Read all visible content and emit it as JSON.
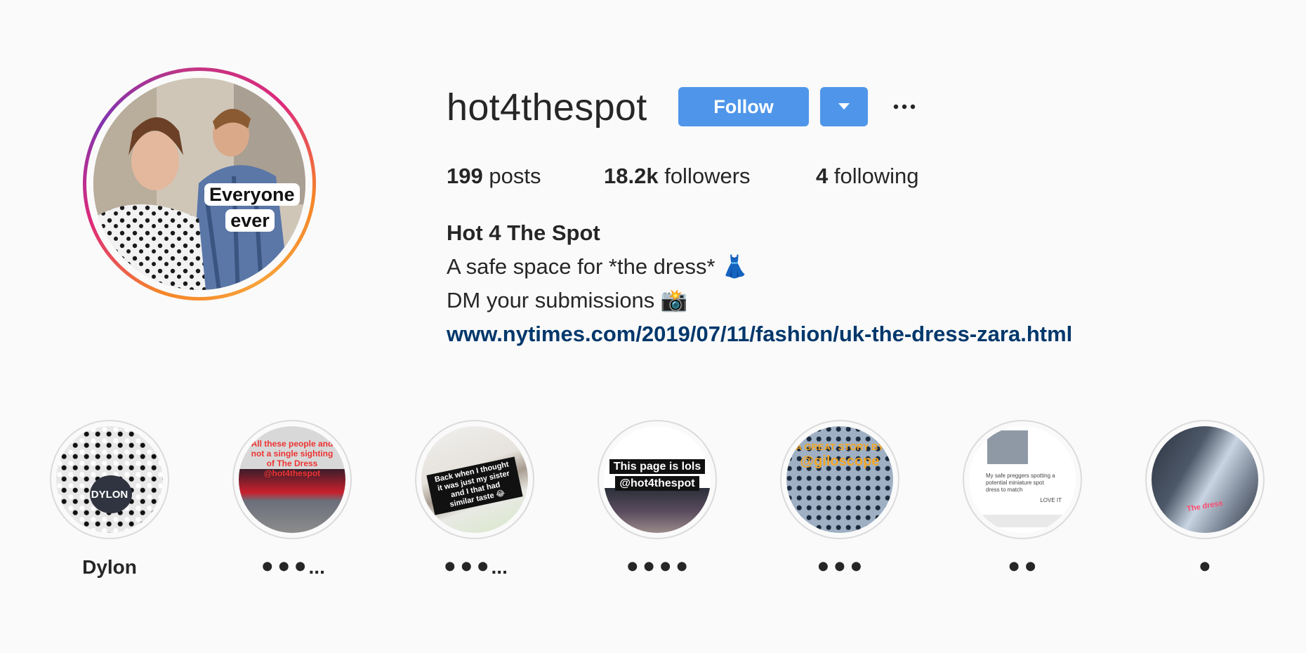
{
  "profile": {
    "username": "hot4thespot",
    "follow_label": "Follow",
    "avatar_caption": "Everyone ever",
    "stats": {
      "posts_count": "199",
      "posts_label": "posts",
      "followers_count": "18.2k",
      "followers_label": "followers",
      "following_count": "4",
      "following_label": "following"
    },
    "bio": {
      "full_name": "Hot 4 The Spot",
      "line1": "A safe space for *the dress* 👗",
      "line2": "DM your submissions 📸",
      "link": "www.nytimes.com/2019/07/11/fashion/uk-the-dress-zara.html"
    }
  },
  "highlights": [
    {
      "label": "Dylon",
      "cover_text": "DYLON"
    },
    {
      "label": "⚫⚫⚫...",
      "cover_text": "All these people and not a single sighting of The Dress @hot4thespot"
    },
    {
      "label": "⚫⚫⚫...",
      "cover_text": "Back when I thought it was just my sister and I that had similar taste 😂"
    },
    {
      "label": "⚫⚫⚫⚫",
      "cover_text": "This page is lols",
      "cover_text2": "@hot4thespot"
    },
    {
      "label": "⚫⚫⚫",
      "cover_text": "A GREAT STORY BY",
      "cover_text2": "@giloscope"
    },
    {
      "label": "⚫⚫",
      "cover_text": "My safe preggers spotting a potential miniature spot dress to match",
      "cover_text2": "LOVE IT"
    },
    {
      "label": "⚫",
      "cover_text": "The dress"
    }
  ],
  "colors": {
    "follow_button": "#4f96ea",
    "link": "#00376b",
    "background": "#fafafa"
  }
}
